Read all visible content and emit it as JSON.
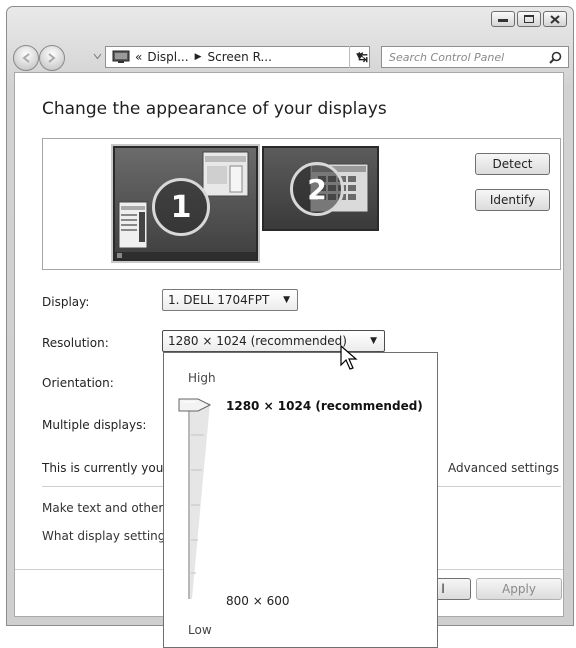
{
  "window": {
    "caption_buttons": [
      {
        "name": "minimize-button",
        "icon": "minimize-icon"
      },
      {
        "name": "maximize-button",
        "icon": "maximize-icon"
      },
      {
        "name": "close-button",
        "icon": "close-icon"
      }
    ]
  },
  "navbar": {
    "address_prefix": "«",
    "breadcrumb": [
      "Displ...",
      "Screen R..."
    ],
    "search_placeholder": "Search Control Panel"
  },
  "main": {
    "title": "Change the appearance of your displays",
    "monitors": [
      "1",
      "2"
    ],
    "detect_label": "Detect",
    "identify_label": "Identify",
    "display_label": "Display:",
    "display_value": "1. DELL 1704FPT",
    "resolution_label": "Resolution:",
    "resolution_value": "1280 × 1024 (recommended)",
    "orientation_label": "Orientation:",
    "multiple_label": "Multiple displays:",
    "current_text": "This is currently you",
    "advanced_link": "Advanced settings",
    "link1": "Make text and other",
    "link2": "What display setting",
    "ok_label": "l",
    "apply_label": "Apply"
  },
  "popup": {
    "high_label": "High",
    "low_label": "Low",
    "top_value": "1280 × 1024 (recommended)",
    "bottom_value": "800 × 600",
    "slider_position": 1.0
  }
}
